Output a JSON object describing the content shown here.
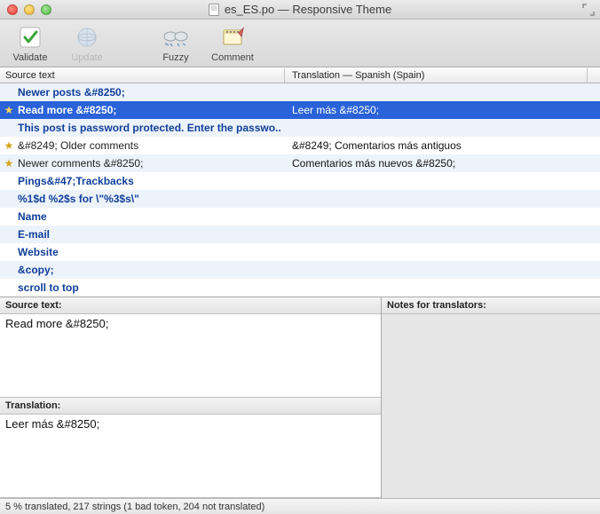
{
  "window": {
    "title": "es_ES.po — Responsive Theme"
  },
  "toolbar": {
    "validate": "Validate",
    "update": "Update",
    "fuzzy": "Fuzzy",
    "comment": "Comment"
  },
  "columns": {
    "source": "Source text",
    "translation": "Translation — Spanish (Spain)"
  },
  "rows": [
    {
      "star": "",
      "src": "Newer posts &#8250;",
      "tr": "",
      "state": "untrans"
    },
    {
      "star": "★",
      "src": "Read more &#8250;",
      "tr": "Leer más &#8250;",
      "state": "sel"
    },
    {
      "star": "",
      "src": "This post is password protected. Enter the passwo..",
      "tr": "",
      "state": "untrans"
    },
    {
      "star": "★",
      "src": "&#8249; Older comments",
      "tr": "&#8249; Comentarios más antiguos",
      "state": "trans"
    },
    {
      "star": "★",
      "src": "Newer comments &#8250;",
      "tr": "Comentarios más nuevos  &#8250;",
      "state": "trans"
    },
    {
      "star": "",
      "src": "Pings&#47;Trackbacks",
      "tr": "",
      "state": "untrans"
    },
    {
      "star": "",
      "src": "%1$d %2$s for \\\"%3$s\\\"",
      "tr": "",
      "state": "untrans"
    },
    {
      "star": "",
      "src": "Name",
      "tr": "",
      "state": "untrans"
    },
    {
      "star": "",
      "src": "E-mail",
      "tr": "",
      "state": "untrans"
    },
    {
      "star": "",
      "src": "Website",
      "tr": "",
      "state": "untrans"
    },
    {
      "star": "",
      "src": "&copy;",
      "tr": "",
      "state": "untrans"
    },
    {
      "star": "",
      "src": "scroll to top",
      "tr": "",
      "state": "untrans"
    }
  ],
  "editor": {
    "source_label": "Source text:",
    "translation_label": "Translation:",
    "notes_label": "Notes for translators:",
    "source_value": "Read more &#8250;",
    "translation_value": "Leer más &#8250;"
  },
  "status": "5 % translated, 217 strings (1 bad token, 204 not translated)"
}
